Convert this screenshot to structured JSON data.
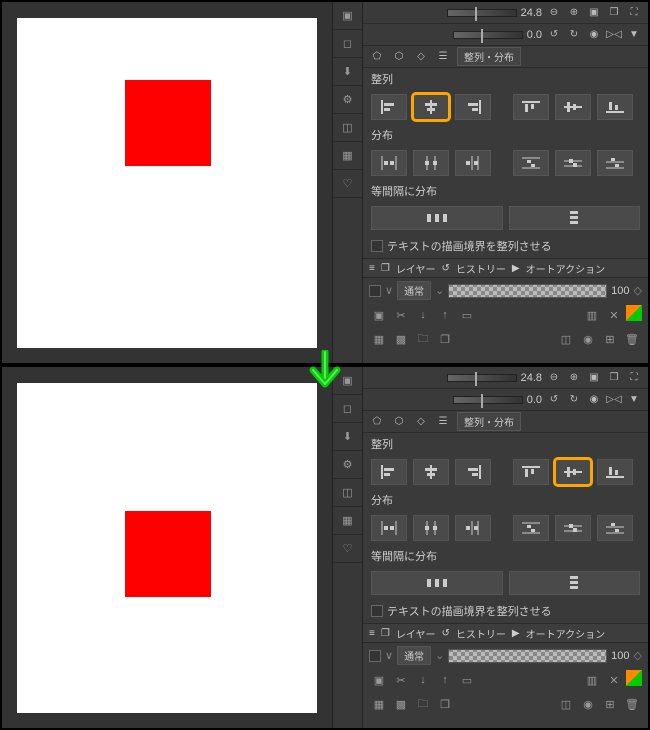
{
  "zoom_value": "24.8",
  "rotation_value": "0.0",
  "panel_tab": "整列・分布",
  "sections": {
    "align": "整列",
    "distribute": "分布",
    "even": "等間隔に分布",
    "textalign": "テキストの描画境界を整列させる"
  },
  "layers": {
    "tab_layer": "レイヤー",
    "tab_history": "ヒストリー",
    "tab_auto": "オートアクション",
    "blend": "通常",
    "opacity": "100"
  },
  "highlight_top": 1,
  "highlight_bottom": 4
}
